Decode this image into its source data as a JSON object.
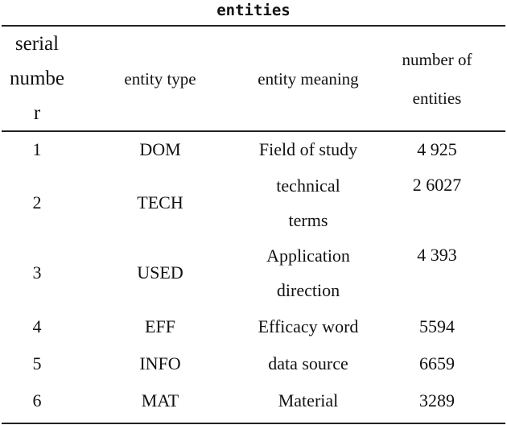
{
  "title": "entities",
  "table": {
    "headers": {
      "serial_number": "serial numbe r",
      "serial_number_lines": [
        "serial",
        "numbe",
        "r"
      ],
      "entity_type": "entity type",
      "entity_meaning": "entity meaning",
      "number_of_entities": "number of entities",
      "number_of_entities_lines": [
        "number of",
        "entities"
      ]
    },
    "rows": [
      {
        "serial": "1",
        "type": "DOM",
        "meaning": "Field of study",
        "meaning_lines": [
          "Field of study"
        ],
        "count": "4 925"
      },
      {
        "serial": "2",
        "type": "TECH",
        "meaning": "technical terms",
        "meaning_lines": [
          "technical",
          "terms"
        ],
        "count": "2 6027"
      },
      {
        "serial": "3",
        "type": "USED",
        "meaning": "Application direction",
        "meaning_lines": [
          "Application",
          "direction"
        ],
        "count": "4 393"
      },
      {
        "serial": "4",
        "type": "EFF",
        "meaning": "Efficacy word",
        "meaning_lines": [
          "Efficacy word"
        ],
        "count": "5594"
      },
      {
        "serial": "5",
        "type": "INFO",
        "meaning": "data source",
        "meaning_lines": [
          "data source"
        ],
        "count": "6659"
      },
      {
        "serial": "6",
        "type": "MAT",
        "meaning": "Material",
        "meaning_lines": [
          "Material"
        ],
        "count": "3289"
      }
    ]
  }
}
